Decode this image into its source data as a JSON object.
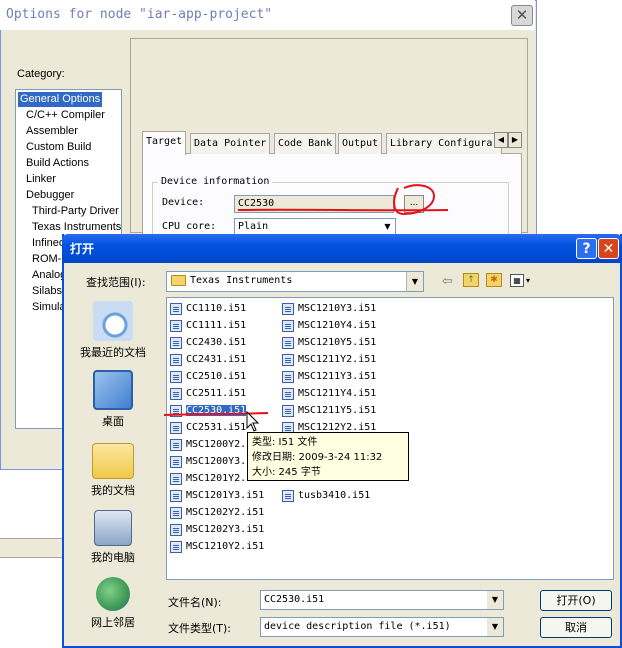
{
  "options_window": {
    "title": "Options for node \"iar-app-project\"",
    "close_glyph": "✕",
    "category_label": "Category:",
    "categories": [
      {
        "label": "General Options",
        "selected": true
      },
      {
        "label": "C/C++ Compiler"
      },
      {
        "label": "Assembler"
      },
      {
        "label": "Custom Build"
      },
      {
        "label": "Build Actions"
      },
      {
        "label": "Linker"
      },
      {
        "label": "Debugger"
      },
      {
        "label": "Third-Party Driver"
      },
      {
        "label": "Texas Instruments"
      },
      {
        "label": "Infineo"
      },
      {
        "label": "ROM-M"
      },
      {
        "label": "Analog"
      },
      {
        "label": "Silabs"
      },
      {
        "label": "Simulat"
      }
    ],
    "tabs": [
      "Target",
      "Data Pointer",
      "Code Bank",
      "Output",
      "Library Configura"
    ],
    "tab_scroll_left": "◀",
    "tab_scroll_right": "▶",
    "group_label": "Device information",
    "device_label": "Device:",
    "device_value": "CC2530",
    "browse_label": "...",
    "cpu_label": "CPU core:",
    "cpu_value": "Plain",
    "dropdown_glyph": "▼"
  },
  "open_dialog": {
    "title": "打开",
    "help_glyph": "?",
    "close_glyph": "✕",
    "look_in_label": "查找范围(I):",
    "look_in_value": "Texas Instruments",
    "dropdown_glyph": "▼",
    "toolbar": {
      "back_glyph": "⇦",
      "up_glyph": "↑",
      "new_folder_glyph": "✱",
      "views_glyph": "▦",
      "views_caret": "▾"
    },
    "places": [
      {
        "label": "我最近的文档",
        "color": "#6aa0dc"
      },
      {
        "label": "桌面",
        "color": "#3f7fd0"
      },
      {
        "label": "我的文档",
        "color": "#f0c94a"
      },
      {
        "label": "我的电脑",
        "color": "#8aa4c8"
      },
      {
        "label": "网上邻居",
        "color": "#3f9a54"
      }
    ],
    "files_col1": [
      "CC1110.i51",
      "CC1111.i51",
      "CC2430.i51",
      "CC2431.i51",
      "CC2510.i51",
      "CC2511.i51",
      "CC2530.i51",
      "CC2531.i51",
      "MSC1200Y2.",
      "MSC1200Y3.",
      "MSC1201Y2.",
      "MSC1201Y3.i51",
      "MSC1202Y2.i51",
      "MSC1202Y3.i51",
      "MSC1210Y2.i51"
    ],
    "files_col2": [
      "MSC1210Y3.i51",
      "MSC1210Y4.i51",
      "MSC1210Y5.i51",
      "MSC1211Y2.i51",
      "MSC1211Y3.i51",
      "MSC1211Y4.i51",
      "MSC1211Y5.i51",
      "MSC1212Y2.i51",
      "",
      "",
      "",
      "tusb3410.i51"
    ],
    "selected_file": "CC2530.i51",
    "tooltip": {
      "type_line": "类型: I51 文件",
      "modified_line": "修改日期: 2009-3-24 11:32",
      "size_line": "大小: 245 字节"
    },
    "file_name_label": "文件名(N):",
    "file_name_value": "CC2530.i51",
    "file_type_label": "文件类型(T):",
    "file_type_value": "device description file (*.i51)",
    "open_button": "打开(O)",
    "cancel_button": "取消"
  },
  "colors": {
    "annotation": "#e8101a",
    "selection": "#316ac5",
    "title_bar": "#0052e0"
  }
}
